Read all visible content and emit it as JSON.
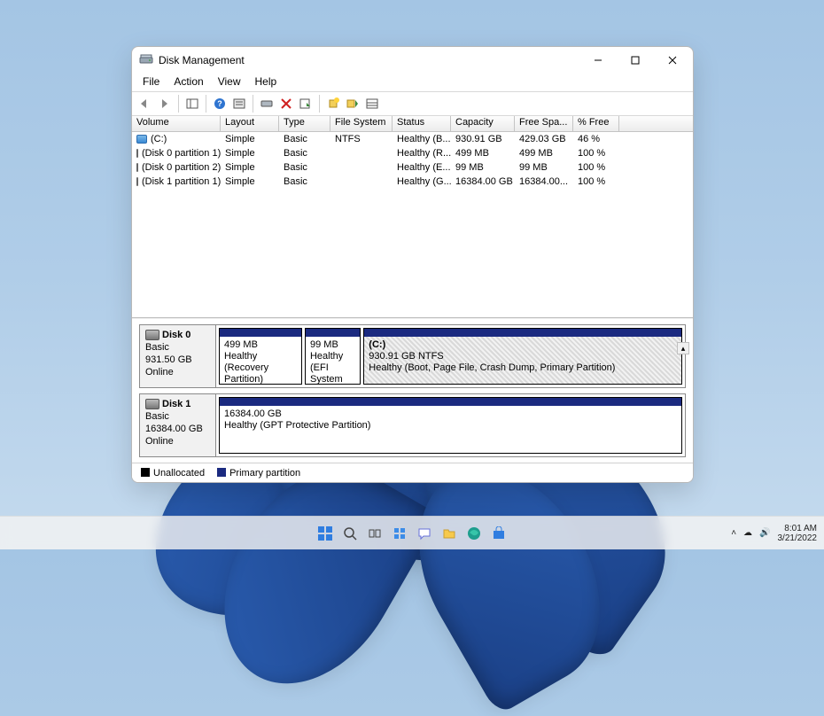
{
  "window": {
    "title": "Disk Management"
  },
  "menu": [
    "File",
    "Action",
    "View",
    "Help"
  ],
  "columns": [
    "Volume",
    "Layout",
    "Type",
    "File System",
    "Status",
    "Capacity",
    "Free Spa...",
    "% Free"
  ],
  "volumes": [
    {
      "icon": "blue",
      "name": "(C:)",
      "layout": "Simple",
      "type": "Basic",
      "fs": "NTFS",
      "status": "Healthy (B...",
      "capacity": "930.91 GB",
      "free": "429.03 GB",
      "pct": "46 %"
    },
    {
      "icon": "gray",
      "name": "(Disk 0 partition 1)",
      "layout": "Simple",
      "type": "Basic",
      "fs": "",
      "status": "Healthy (R...",
      "capacity": "499 MB",
      "free": "499 MB",
      "pct": "100 %"
    },
    {
      "icon": "gray",
      "name": "(Disk 0 partition 2)",
      "layout": "Simple",
      "type": "Basic",
      "fs": "",
      "status": "Healthy (E...",
      "capacity": "99 MB",
      "free": "99 MB",
      "pct": "100 %"
    },
    {
      "icon": "gray",
      "name": "(Disk 1 partition 1)",
      "layout": "Simple",
      "type": "Basic",
      "fs": "",
      "status": "Healthy (G...",
      "capacity": "16384.00 GB",
      "free": "16384.00...",
      "pct": "100 %"
    }
  ],
  "disks": [
    {
      "name": "Disk 0",
      "type": "Basic",
      "size": "931.50 GB",
      "status": "Online",
      "parts": [
        {
          "title": "",
          "line1": "499 MB",
          "line2": "Healthy (Recovery Partition)",
          "flex": 18,
          "selected": false
        },
        {
          "title": "",
          "line1": "99 MB",
          "line2": "Healthy (EFI System",
          "flex": 12,
          "selected": false
        },
        {
          "title": "(C:)",
          "line1": "930.91 GB NTFS",
          "line2": "Healthy (Boot, Page File, Crash Dump, Primary Partition)",
          "flex": 70,
          "selected": true
        }
      ]
    },
    {
      "name": "Disk 1",
      "type": "Basic",
      "size": "16384.00 GB",
      "status": "Online",
      "parts": [
        {
          "title": "",
          "line1": "16384.00 GB",
          "line2": "Healthy (GPT Protective Partition)",
          "flex": 100,
          "selected": false
        }
      ]
    }
  ],
  "legend": {
    "unalloc": "Unallocated",
    "primary": "Primary partition"
  },
  "tray": {
    "time": "8:01 AM",
    "date": "3/21/2022"
  }
}
